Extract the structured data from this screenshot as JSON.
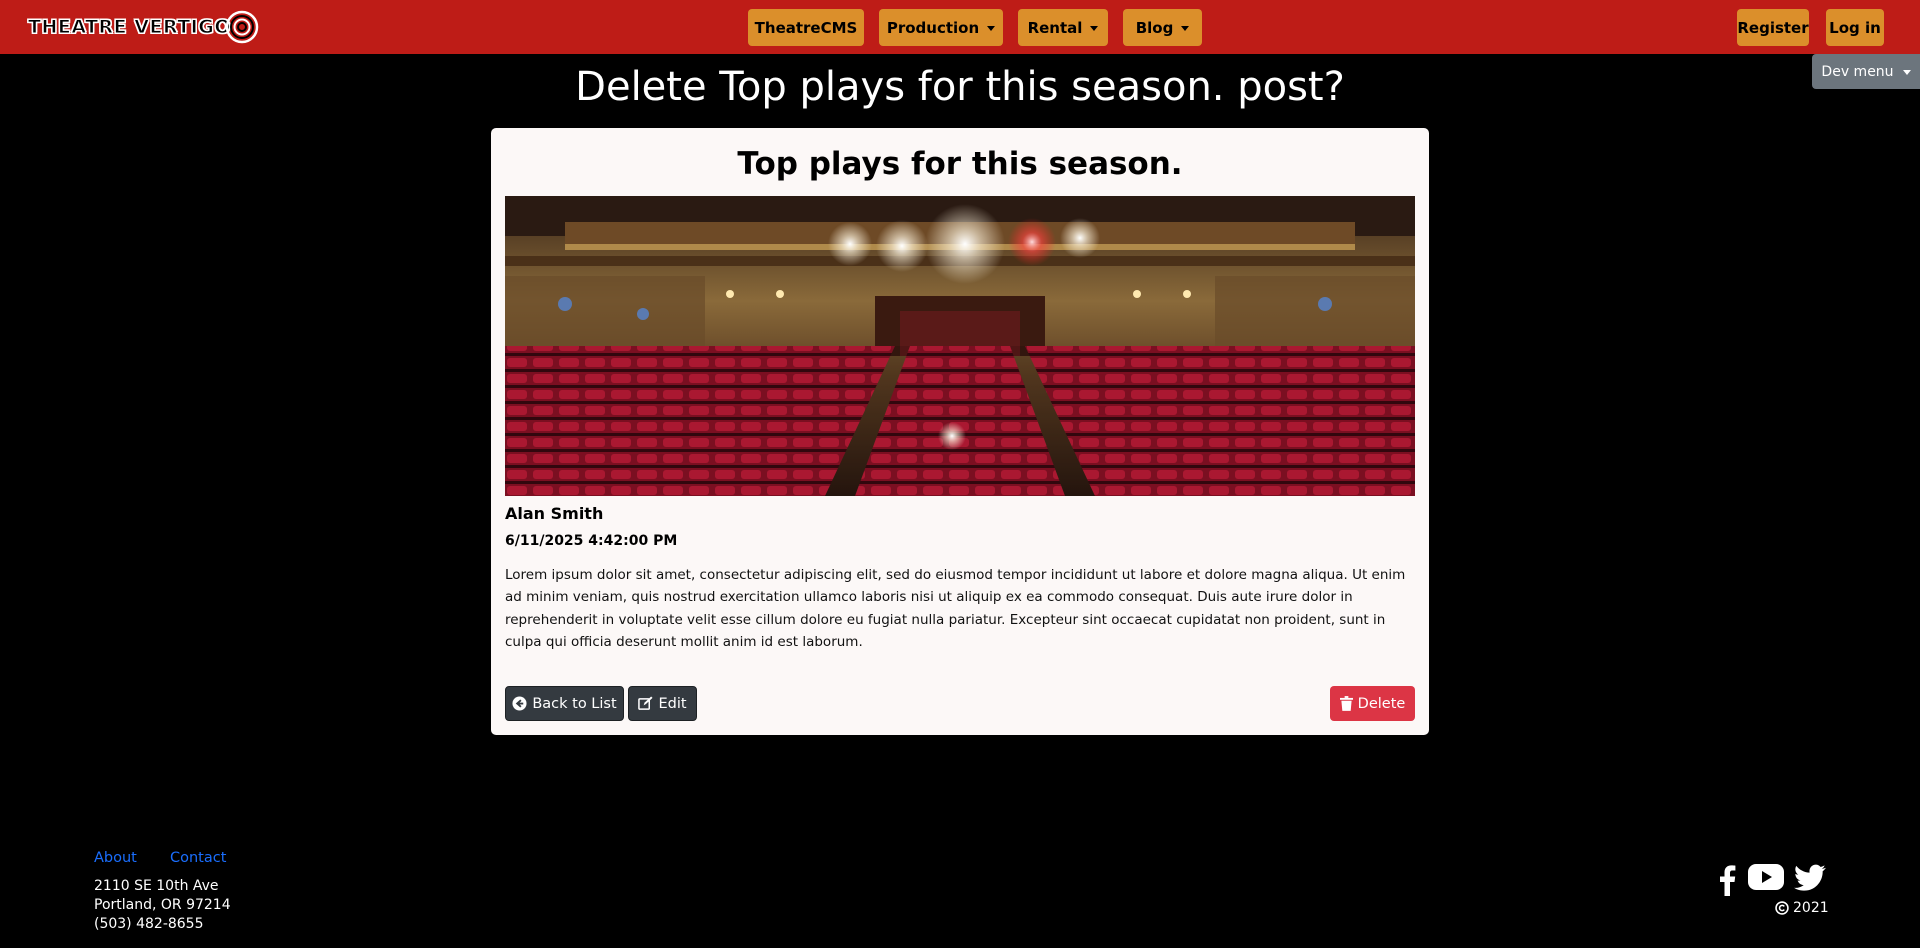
{
  "nav": {
    "brand": "THEATRE VERTIGO",
    "items": [
      {
        "label": "TheatreCMS",
        "dropdown": false
      },
      {
        "label": "Production",
        "dropdown": true
      },
      {
        "label": "Rental",
        "dropdown": true
      },
      {
        "label": "Blog",
        "dropdown": true
      }
    ],
    "register": "Register",
    "login": "Log in",
    "dev_menu": "Dev menu"
  },
  "page": {
    "title": "Delete Top plays for this season. post?"
  },
  "post": {
    "title": "Top plays for this season.",
    "author": "Alan Smith",
    "date": "6/11/2025 4:42:00 PM",
    "body": "Lorem ipsum dolor sit amet, consectetur adipiscing elit, sed do eiusmod tempor incididunt ut labore et dolore magna aliqua. Ut enim ad minim veniam, quis nostrud exercitation ullamco laboris nisi ut aliquip ex ea commodo consequat. Duis aute irure dolor in reprehenderit in voluptate velit esse cillum dolore eu fugiat nulla pariatur. Excepteur sint occaecat cupidatat non proident, sunt in culpa qui officia deserunt mollit anim id est laborum."
  },
  "actions": {
    "back": "Back to List",
    "edit": "Edit",
    "delete": "Delete"
  },
  "footer": {
    "links": [
      "About",
      "Contact"
    ],
    "address": [
      "2110 SE 10th Ave",
      "Portland, OR 97214",
      "(503) 482-8655"
    ],
    "copyright": "2021",
    "social": [
      "facebook-icon",
      "youtube-icon",
      "twitter-icon"
    ]
  },
  "colors": {
    "navbar": "#be1c17",
    "nav_button": "#db8f2b",
    "card": "#fcf8f7",
    "danger": "#dc3545",
    "dark": "#343a40",
    "link": "#1a6efd"
  }
}
